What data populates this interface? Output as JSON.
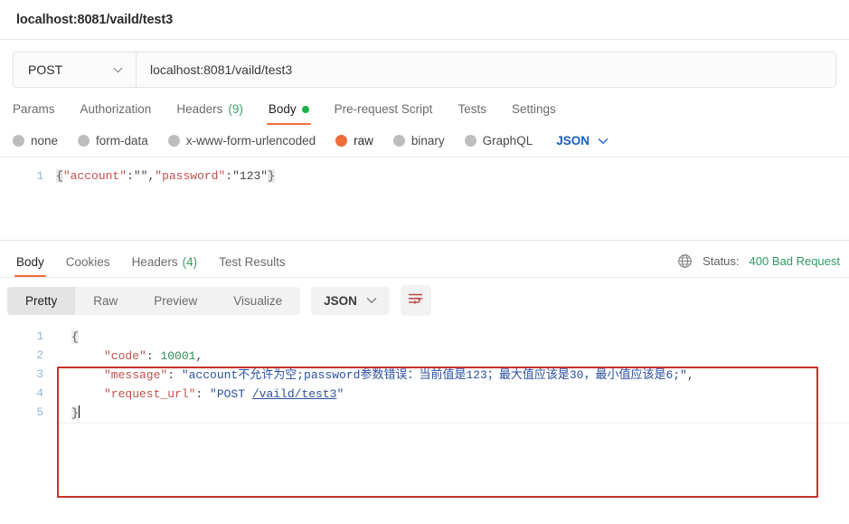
{
  "window": {
    "tab_title": "localhost:8081/vaild/test3"
  },
  "request": {
    "method": "POST",
    "method_chevron_icon": "chevron-down-icon",
    "url": "localhost:8081/vaild/test3",
    "tabs": [
      {
        "label": "Params",
        "active": false,
        "count": "",
        "dot": false
      },
      {
        "label": "Authorization",
        "active": false,
        "count": "",
        "dot": false
      },
      {
        "label": "Headers",
        "active": false,
        "count": "(9)",
        "dot": false
      },
      {
        "label": "Body",
        "active": true,
        "count": "",
        "dot": true
      },
      {
        "label": "Pre-request Script",
        "active": false,
        "count": "",
        "dot": false
      },
      {
        "label": "Tests",
        "active": false,
        "count": "",
        "dot": false
      },
      {
        "label": "Settings",
        "active": false,
        "count": "",
        "dot": false
      }
    ],
    "body_types": [
      {
        "label": "none",
        "selected": false
      },
      {
        "label": "form-data",
        "selected": false
      },
      {
        "label": "x-www-form-urlencoded",
        "selected": false
      },
      {
        "label": "raw",
        "selected": true
      },
      {
        "label": "binary",
        "selected": false
      },
      {
        "label": "GraphQL",
        "selected": false
      }
    ],
    "raw_format": "JSON",
    "raw_format_chevron_icon": "chevron-down-icon",
    "editor": {
      "line_numbers": [
        "1"
      ],
      "open_brace": "{",
      "key_account": "\"account\"",
      "colon1": ":",
      "value_account": "\"\"",
      "comma1": ",",
      "key_password": "\"password\"",
      "colon2": ":",
      "value_password": "\"123\"",
      "close_brace": "}",
      "full_text": "{\"account\":\"\",\"password\":\"123\"}"
    }
  },
  "response": {
    "tabs": [
      {
        "label": "Body",
        "active": true,
        "count": ""
      },
      {
        "label": "Cookies",
        "active": false,
        "count": ""
      },
      {
        "label": "Headers",
        "active": false,
        "count": "(4)"
      },
      {
        "label": "Test Results",
        "active": false,
        "count": ""
      }
    ],
    "globe_icon": "globe-icon",
    "status_label": "Status:",
    "status_value": "400 Bad Request",
    "status_color": "#2e9b63",
    "view_modes": [
      {
        "label": "Pretty",
        "active": true
      },
      {
        "label": "Raw",
        "active": false
      },
      {
        "label": "Preview",
        "active": false
      },
      {
        "label": "Visualize",
        "active": false
      }
    ],
    "format": "JSON",
    "format_chevron_icon": "chevron-down-icon",
    "wrap_icon": "word-wrap-icon",
    "body": {
      "line_numbers": [
        "1",
        "2",
        "3",
        "4",
        "5"
      ],
      "open_brace": "{",
      "close_brace": "}",
      "rows": [
        {
          "key": "\"code\"",
          "sep": ": ",
          "value": "10001",
          "value_type": "number",
          "trail": ","
        },
        {
          "key": "\"message\"",
          "sep": ": ",
          "value": "\"account不允许为空;password参数错误：当前值是123；最大值应该是30，最小值应该是6;\"",
          "value_type": "string",
          "trail": ","
        },
        {
          "key": "\"request_url\"",
          "sep": ": ",
          "value_prefix": "\"POST ",
          "value_link": "/vaild/test3",
          "value_suffix": "\"",
          "value_type": "string-link",
          "trail": ""
        }
      ]
    }
  },
  "annotation": {
    "type": "red-rectangle-highlight",
    "color": "#c9302c"
  }
}
